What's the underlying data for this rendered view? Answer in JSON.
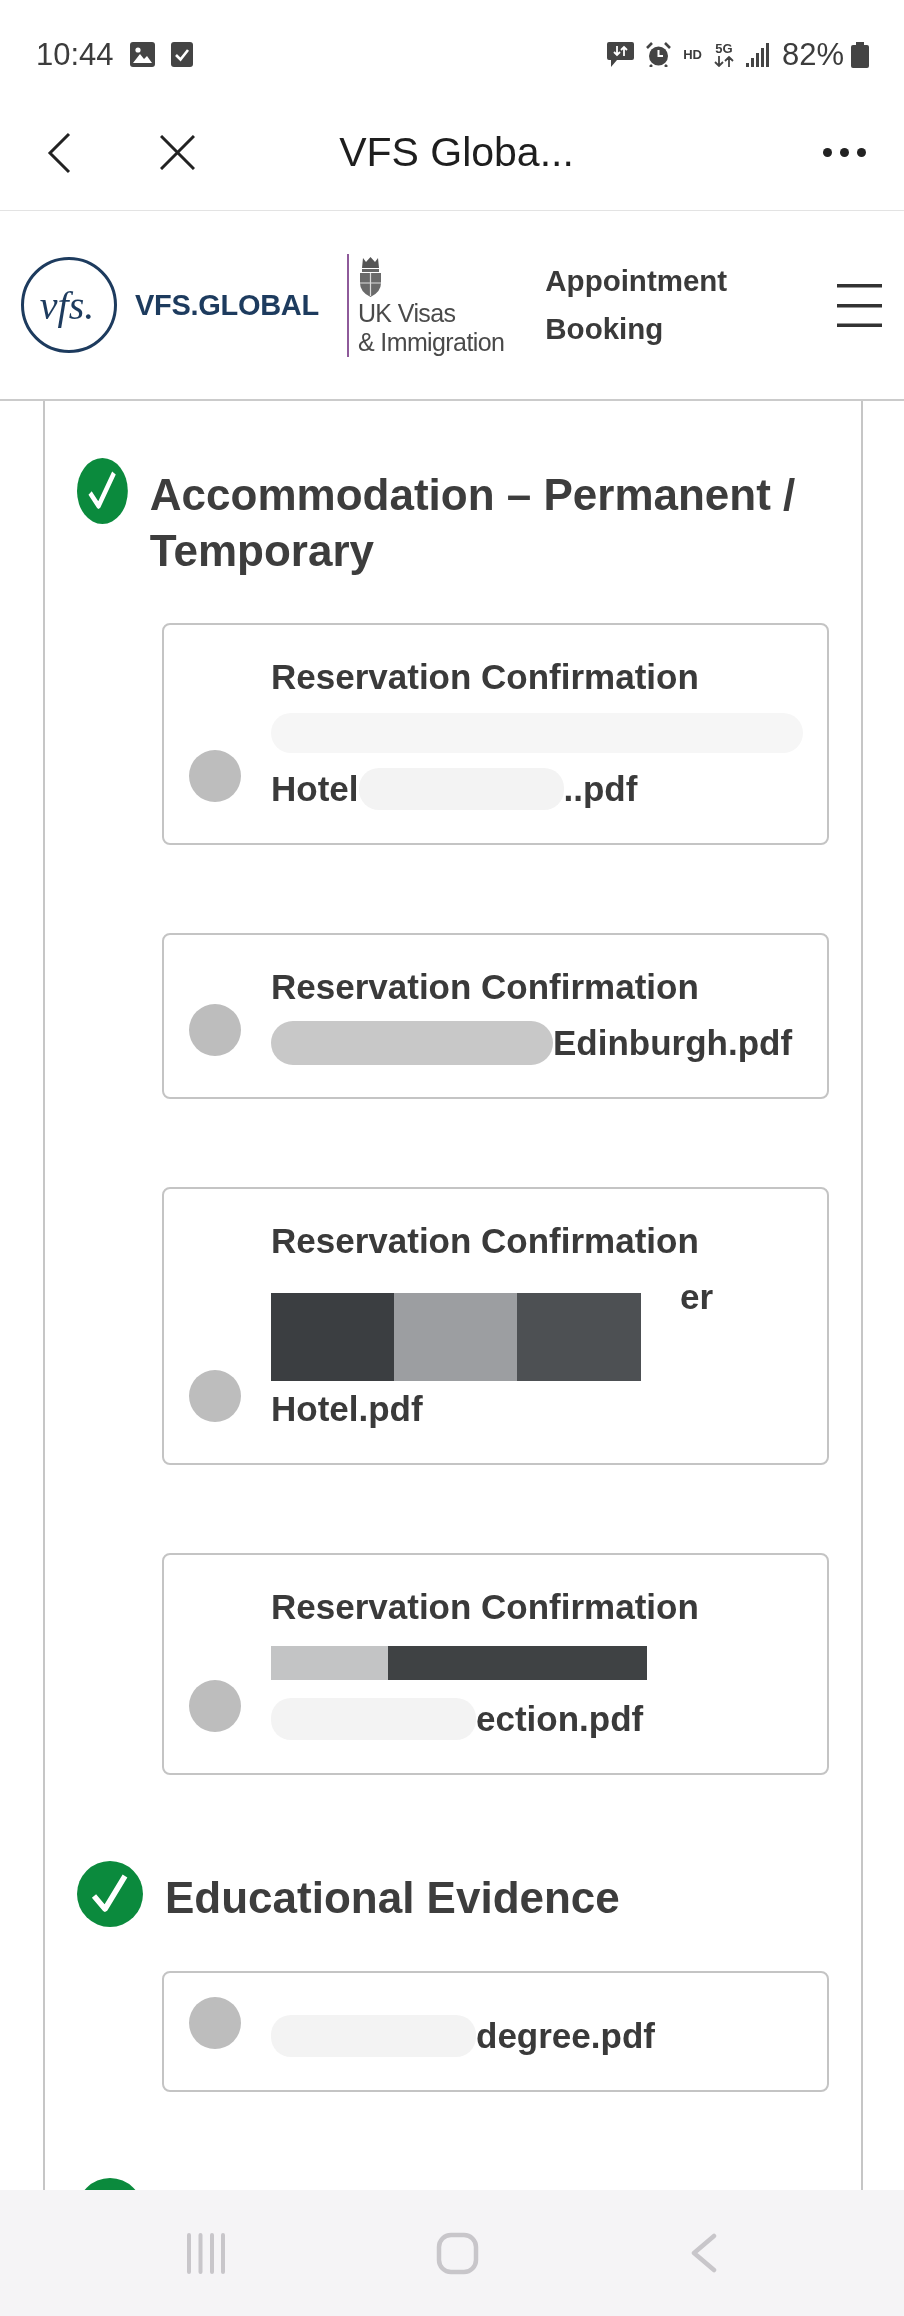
{
  "status_bar": {
    "time": "10:44",
    "hd_label": "HD",
    "network_label": "5G",
    "battery_text": "82%"
  },
  "browser_bar": {
    "title": "VFS Globa..."
  },
  "site_header": {
    "logo_mark": "vfs.",
    "logo_text": "VFS.GLOBAL",
    "agency_lines": [
      "UK Visas",
      "& Immigration"
    ],
    "page_title": "Appointment Booking"
  },
  "sections": [
    {
      "title": "Accommodation – Permanent / Temporary",
      "done": true,
      "files": [
        {
          "title": "Reservation Confirmation",
          "selected": false,
          "name_lines": [
            [
              {
                "kind": "smudge"
              }
            ],
            [
              {
                "kind": "text",
                "text": "Hotel"
              },
              {
                "kind": "smudge"
              },
              {
                "kind": "text",
                "text": "..pdf"
              }
            ]
          ]
        },
        {
          "title": "Reservation Confirmation",
          "selected": false,
          "name_lines": [
            [
              {
                "kind": "blot"
              },
              {
                "kind": "text",
                "text": "Edinburgh.pdf"
              }
            ]
          ]
        },
        {
          "title": "Reservation Confirmation",
          "selected": false,
          "name_lines": [
            [
              {
                "kind": "stripes"
              },
              {
                "kind": "text",
                "text": "er"
              }
            ],
            [
              {
                "kind": "stripes"
              }
            ],
            [
              {
                "kind": "text",
                "text": "Hotel.pdf"
              }
            ]
          ]
        },
        {
          "title": "Reservation Confirmation",
          "selected": false,
          "name_lines": [
            [
              {
                "kind": "bar"
              }
            ],
            [
              {
                "kind": "smudge"
              },
              {
                "kind": "text",
                "text": "ection.pdf"
              }
            ]
          ]
        }
      ]
    },
    {
      "title": "Educational Evidence",
      "done": true,
      "files": [
        {
          "selected": false,
          "name_lines": [
            [
              {
                "kind": "smudge"
              },
              {
                "kind": "text",
                "text": "degree.pdf"
              }
            ]
          ]
        }
      ]
    },
    {
      "done": true
    }
  ]
}
